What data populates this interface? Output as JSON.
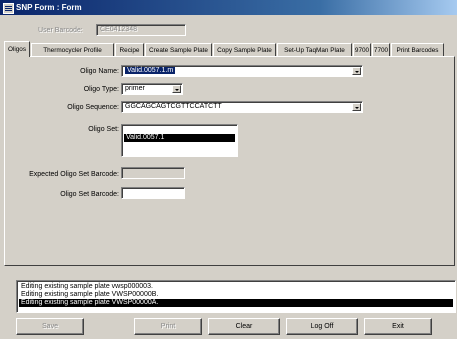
{
  "window": {
    "title": "SNP Form : Form"
  },
  "header": {
    "user_barcode_label": "User Barcode:",
    "user_barcode_value": "CE0412348"
  },
  "tabs": [
    {
      "label": "Oligos",
      "active": true
    },
    {
      "label": "Thermocycler Profile"
    },
    {
      "label": "Recipe"
    },
    {
      "label": "Create Sample Plate"
    },
    {
      "label": "Copy Sample Plate"
    },
    {
      "label": "Set-Up TaqMan Plate"
    },
    {
      "label": "9700"
    },
    {
      "label": "7700"
    },
    {
      "label": "Print Barcodes"
    }
  ],
  "form": {
    "oligo_name_label": "Oligo Name:",
    "oligo_name_value": "Valid.0057.1.m",
    "oligo_type_label": "Oligo Type:",
    "oligo_type_value": "primer",
    "oligo_sequence_label": "Oligo Sequence:",
    "oligo_sequence_value": "GGCAGCAGTCGTTCCATCTT",
    "oligo_set_label": "Oligo Set:",
    "oligo_set_items": [
      {
        "label": "Valid.0057.1",
        "selected": true
      }
    ],
    "expected_barcode_label": "Expected Oligo Set Barcode:",
    "expected_barcode_value": "",
    "oligo_set_barcode_label": "Oligo Set Barcode:",
    "oligo_set_barcode_value": ""
  },
  "log": [
    {
      "text": "Editing existing sample plate vwsp000003.",
      "selected": false
    },
    {
      "text": "Editing existing sample plate VWSP00000B.",
      "selected": false
    },
    {
      "text": "Editing existing sample plate VWSP00000A.",
      "selected": true
    }
  ],
  "buttons": {
    "save": "Save",
    "print": "Print",
    "clear": "Clear",
    "logoff": "Log Off",
    "exit": "Exit"
  }
}
